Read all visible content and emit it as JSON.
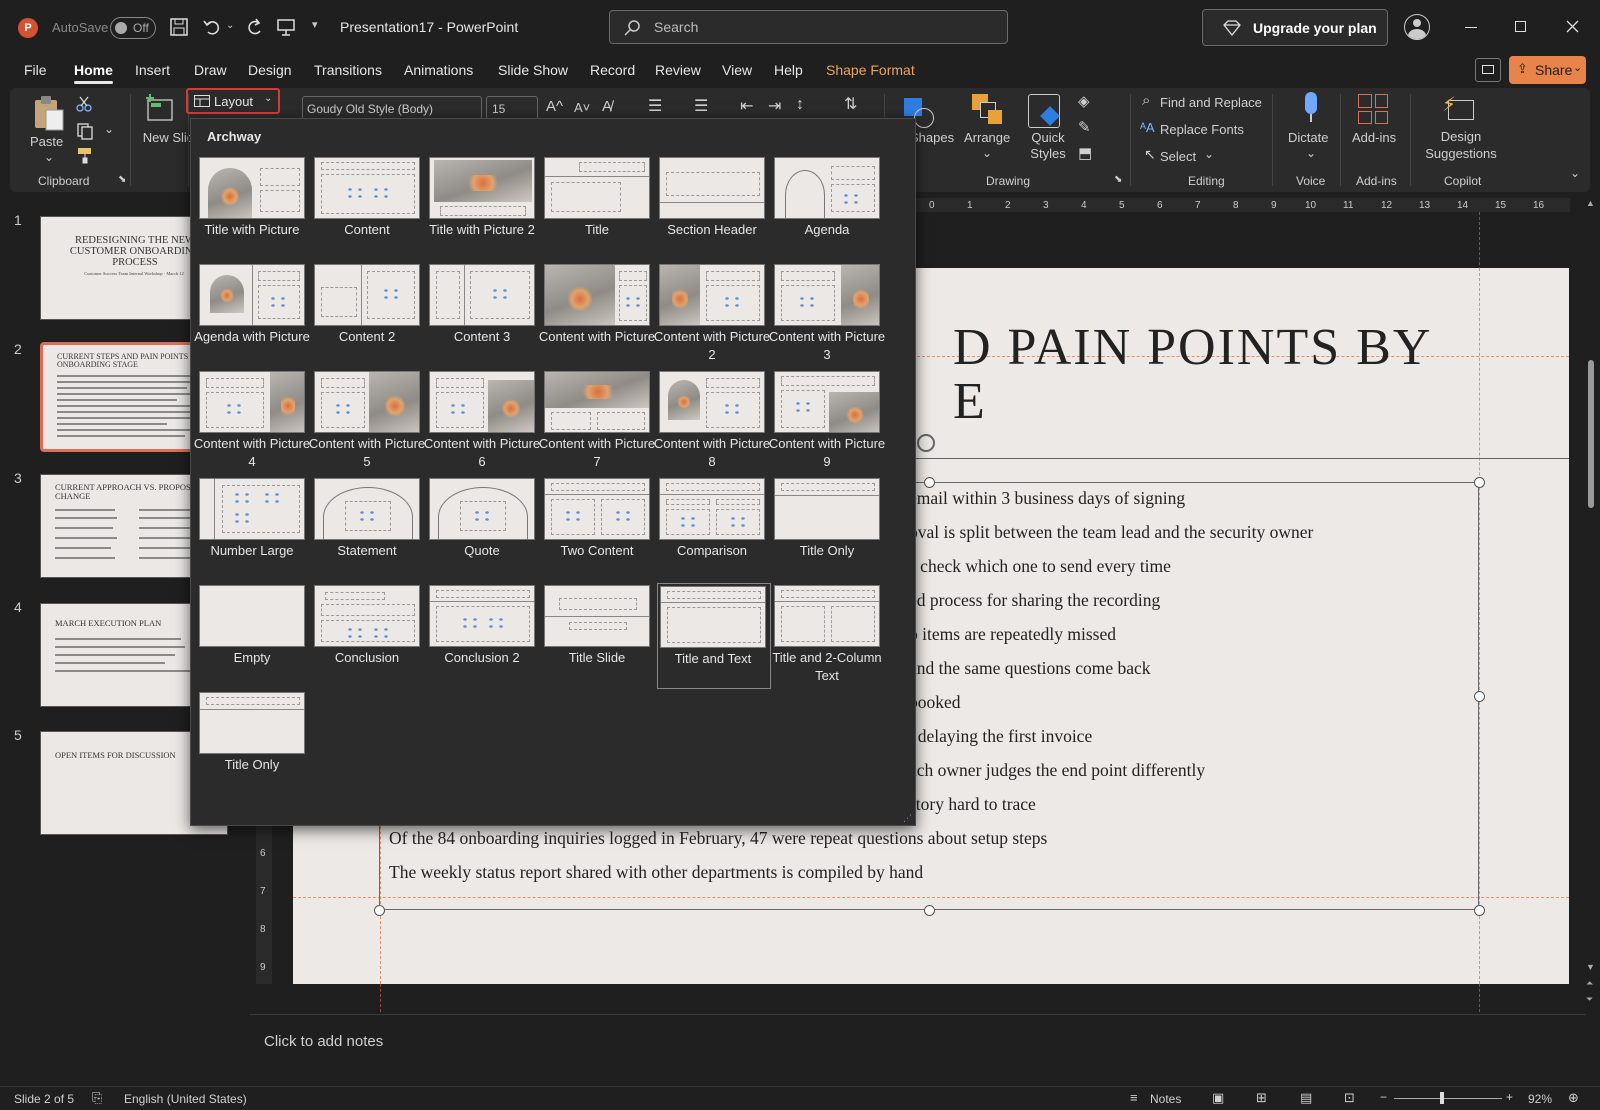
{
  "titlebar": {
    "autosave_label": "AutoSave",
    "autosave_state": "Off",
    "document_title": "Presentation17 - PowerPoint",
    "search_placeholder": "Search",
    "upgrade_label": "Upgrade your plan",
    "share_label": "Share"
  },
  "menu": {
    "tabs": [
      "File",
      "Home",
      "Insert",
      "Draw",
      "Design",
      "Transitions",
      "Animations",
      "Slide Show",
      "Record",
      "Review",
      "View",
      "Help",
      "Shape Format"
    ],
    "active": "Home",
    "accent_tab": "Shape Format"
  },
  "ribbon": {
    "paste": "Paste",
    "new_slide": "New Slide",
    "layout": "Layout",
    "font_name": "Goudy Old Style (Body)",
    "font_size": "15",
    "shapes": "Shapes",
    "arrange": "Arrange",
    "quick_styles": "Quick Styles",
    "find_replace": "Find and Replace",
    "replace_fonts": "Replace Fonts",
    "select": "Select",
    "dictate": "Dictate",
    "addins": "Add-ins",
    "design_suggestions": "Design Suggestions",
    "groups": {
      "clipboard": "Clipboard",
      "drawing": "Drawing",
      "editing": "Editing",
      "voice": "Voice",
      "addins": "Add-ins",
      "copilot": "Copilot"
    }
  },
  "gallery": {
    "theme_name": "Archway",
    "layouts": [
      "Title with Picture",
      "Content",
      "Title with Picture 2",
      "Title",
      "Section Header",
      "Agenda",
      "Agenda with Picture",
      "Content 2",
      "Content 3",
      "Content with Picture",
      "Content with Picture 2",
      "Content with Picture 3",
      "Content with Picture 4",
      "Content with Picture 5",
      "Content with Picture 6",
      "Content with Picture 7",
      "Content with Picture 8",
      "Content with Picture 9",
      "Number Large",
      "Statement",
      "Quote",
      "Two Content",
      "Comparison",
      "Title Only",
      "Empty",
      "Conclusion",
      "Conclusion 2",
      "Title Slide",
      "Title and Text",
      "Title and 2-Column Text",
      "Title Only"
    ],
    "selected": "Title and Text"
  },
  "slides": [
    {
      "num": "1",
      "title": "REDESIGNING THE NEW CUSTOMER ONBOARDING PROCESS",
      "subtitle": "Customer Success Team Internal Workshop · March 12"
    },
    {
      "num": "2",
      "title": "CURRENT STEPS AND PAIN POINTS BY ONBOARDING STAGE"
    },
    {
      "num": "3",
      "title": "CURRENT APPROACH VS. PROPOSED CHANGE"
    },
    {
      "num": "4",
      "title": "MARCH EXECUTION PLAN"
    },
    {
      "num": "5",
      "title": "OPEN ITEMS FOR DISCUSSION"
    }
  ],
  "slide": {
    "title_line1": "D PAIN POINTS BY",
    "title_line2": "E",
    "bullets": [
      "email within 3 business days of signing",
      "oval is split between the team lead and the security owner",
      "s check which one to send every time",
      "ed process for sharing the recording",
      "o items are repeatedly missed",
      " and the same questions come back",
      " booked",
      ", delaying the first invoice",
      "ach owner judges the end point differently",
      "story hard to trace",
      "Of the 84 onboarding inquiries logged in February, 47 were repeat questions about setup steps",
      "The weekly status report shared with other departments is compiled by hand"
    ]
  },
  "notes_placeholder": "Click to add notes",
  "status": {
    "slide_counter": "Slide 2 of 5",
    "language": "English (United States)",
    "notes": "Notes",
    "zoom": "92%"
  },
  "ruler": {
    "h": [
      "0",
      "1",
      "2",
      "3",
      "4",
      "5",
      "6",
      "7",
      "8",
      "9",
      "10",
      "11",
      "12",
      "13",
      "14",
      "15",
      "16"
    ],
    "v": [
      "6",
      "7",
      "8",
      "9"
    ]
  },
  "colors": {
    "accent": "#f0a35a",
    "share": "#e8834a",
    "selection": "#e06c56",
    "layout_outline": "#d83a3a"
  }
}
